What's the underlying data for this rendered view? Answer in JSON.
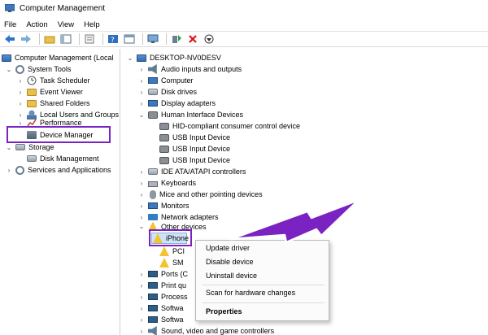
{
  "window": {
    "title": "Computer Management"
  },
  "menu": [
    "File",
    "Action",
    "View",
    "Help"
  ],
  "left_tree": [
    {
      "label": "Computer Management (Local",
      "level": 0,
      "chevron": "",
      "icon": "pc"
    },
    {
      "label": "System Tools",
      "level": 1,
      "chevron": "v",
      "icon": "gear"
    },
    {
      "label": "Task Scheduler",
      "level": 2,
      "chevron": ">",
      "icon": "clock"
    },
    {
      "label": "Event Viewer",
      "level": 2,
      "chevron": ">",
      "icon": "folder"
    },
    {
      "label": "Shared Folders",
      "level": 2,
      "chevron": ">",
      "icon": "folder"
    },
    {
      "label": "Local Users and Groups",
      "level": 2,
      "chevron": ">",
      "icon": "users"
    },
    {
      "label": "Performance",
      "level": 2,
      "chevron": ">",
      "icon": "chart"
    },
    {
      "label": "Device Manager",
      "level": 2,
      "chevron": "",
      "icon": "device-manager"
    },
    {
      "label": "Storage",
      "level": 1,
      "chevron": "v",
      "icon": "disk"
    },
    {
      "label": "Disk Management",
      "level": 2,
      "chevron": "",
      "icon": "disk"
    },
    {
      "label": "Services and Applications",
      "level": 1,
      "chevron": ">",
      "icon": "gear"
    }
  ],
  "right_tree": [
    {
      "label": "DESKTOP-NV0DESV",
      "level": 0,
      "chevron": "v",
      "icon": "pc"
    },
    {
      "label": "Audio inputs and outputs",
      "level": 1,
      "chevron": ">",
      "icon": "speaker"
    },
    {
      "label": "Computer",
      "level": 1,
      "chevron": ">",
      "icon": "monitor"
    },
    {
      "label": "Disk drives",
      "level": 1,
      "chevron": ">",
      "icon": "disk"
    },
    {
      "label": "Display adapters",
      "level": 1,
      "chevron": ">",
      "icon": "monitor"
    },
    {
      "label": "Human Interface Devices",
      "level": 1,
      "chevron": "v",
      "icon": "hid"
    },
    {
      "label": "HID-compliant consumer control device",
      "level": 2,
      "chevron": "",
      "icon": "hid"
    },
    {
      "label": "USB Input Device",
      "level": 2,
      "chevron": "",
      "icon": "hid"
    },
    {
      "label": "USB Input Device",
      "level": 2,
      "chevron": "",
      "icon": "hid"
    },
    {
      "label": "USB Input Device",
      "level": 2,
      "chevron": "",
      "icon": "hid"
    },
    {
      "label": "IDE ATA/ATAPI controllers",
      "level": 1,
      "chevron": ">",
      "icon": "disk"
    },
    {
      "label": "Keyboards",
      "level": 1,
      "chevron": ">",
      "icon": "keyboard"
    },
    {
      "label": "Mice and other pointing devices",
      "level": 1,
      "chevron": ">",
      "icon": "mouse"
    },
    {
      "label": "Monitors",
      "level": 1,
      "chevron": ">",
      "icon": "monitor"
    },
    {
      "label": "Network adapters",
      "level": 1,
      "chevron": ">",
      "icon": "network"
    },
    {
      "label": "Other devices",
      "level": 1,
      "chevron": "v",
      "icon": "warning"
    },
    {
      "label": "iPhone",
      "level": 2,
      "chevron": "",
      "icon": "warning"
    },
    {
      "label": "PCI",
      "level": 2,
      "chevron": "",
      "icon": "warning"
    },
    {
      "label": "SM",
      "level": 2,
      "chevron": "",
      "icon": "warning"
    },
    {
      "label": "Ports (C",
      "level": 1,
      "chevron": ">",
      "icon": "chip"
    },
    {
      "label": "Print qu",
      "level": 1,
      "chevron": ">",
      "icon": "chip"
    },
    {
      "label": "Process",
      "level": 1,
      "chevron": ">",
      "icon": "chip"
    },
    {
      "label": "Softwa",
      "level": 1,
      "chevron": ">",
      "icon": "chip"
    },
    {
      "label": "Softwa",
      "level": 1,
      "chevron": ">",
      "icon": "chip"
    },
    {
      "label": "Sound, video and game controllers",
      "level": 1,
      "chevron": ">",
      "icon": "speaker"
    }
  ],
  "context_menu": {
    "items": [
      "Update driver",
      "Disable device",
      "Uninstall device",
      "Scan for hardware changes",
      "Properties"
    ]
  },
  "colors": {
    "annotation": "#7b22c2",
    "selection": "#cfe3f7"
  }
}
